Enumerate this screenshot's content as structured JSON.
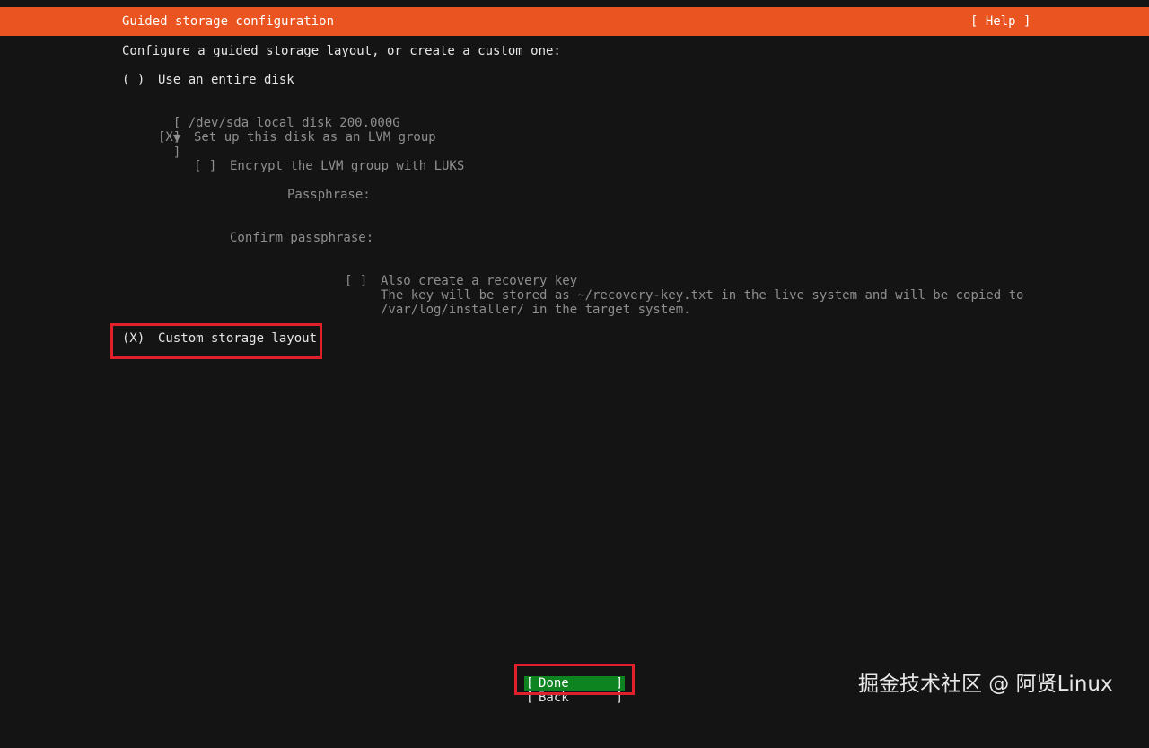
{
  "header": {
    "title": "Guided storage configuration",
    "help_label": "[ Help ]",
    "color": "#e95420"
  },
  "intro": "Configure a guided storage layout, or create a custom one:",
  "entire_disk": {
    "radio": "( )",
    "label": "Use an entire disk",
    "disk_select_open": "[ /dev/sda local disk 200.000G",
    "disk_select_caret": "▼",
    "disk_select_close": "]",
    "lvm_checkbox": "[X]",
    "lvm_label": "Set up this disk as an LVM group",
    "encrypt_checkbox": "[ ]",
    "encrypt_label": "Encrypt the LVM group with LUKS",
    "passphrase_label": "Passphrase:",
    "passphrase_value": "",
    "confirm_label": "Confirm passphrase:",
    "confirm_value": "",
    "recovery_checkbox": "[ ]",
    "recovery_label": "Also create a recovery key",
    "recovery_note_1": "The key will be stored as ~/recovery-key.txt in the live system and will be copied to",
    "recovery_note_2": "/var/log/installer/ in the target system."
  },
  "custom_layout": {
    "radio": "(X)",
    "label": "Custom storage layout"
  },
  "buttons": {
    "done_open": "[",
    "done_label": "Done",
    "done_close": "]",
    "back_open": "[",
    "back_label": "Back",
    "back_close": "]",
    "done_color": "#0e8420"
  },
  "annotation_color": "#e0202a",
  "watermark": "掘金技术社区 @ 阿贤Linux"
}
